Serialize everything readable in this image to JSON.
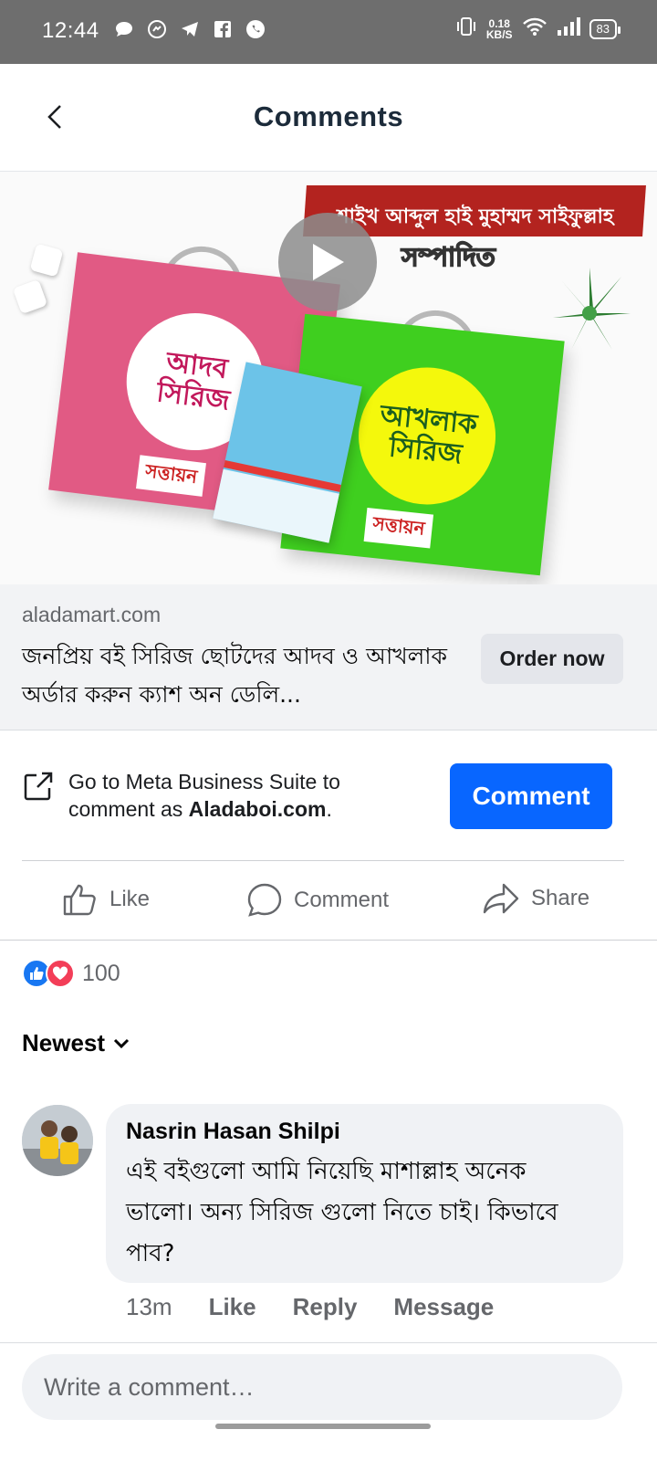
{
  "status_bar": {
    "time": "12:44",
    "net_speed_value": "0.18",
    "net_speed_unit": "KB/S",
    "battery": "83"
  },
  "header": {
    "title": "Comments"
  },
  "ad_media": {
    "banner_text": "শাইখ আব্দুল হাই মুহাম্মদ সাইফুল্লাহ",
    "banner_sub": "সম্পাদিত",
    "pink_bag_label": "আদব সিরিজ",
    "green_bag_label": "আখলাক সিরিজ",
    "brand": "সত্তায়ন"
  },
  "link_preview": {
    "domain": "aladamart.com",
    "title": "জনপ্রিয় বই সিরিজ ছোটদের আদব ও আখলাক অর্ডার করুন ক্যাশ অন ডেলি...",
    "button": "Order now"
  },
  "business_suite": {
    "text_prefix": "Go to Meta Business Suite to comment as ",
    "page_name": "Aladaboi.com",
    "text_suffix": ".",
    "button": "Comment"
  },
  "actions": {
    "like": "Like",
    "comment": "Comment",
    "share": "Share"
  },
  "reactions": {
    "count": "100"
  },
  "sort": {
    "label": "Newest"
  },
  "comments": [
    {
      "author": "Nasrin Hasan Shilpi",
      "text": "এই বইগুলো আমি নিয়েছি মাশাল্লাহ অনেক ভালো। অন্য সিরিজ গুলো নিতে চাই। কিভাবে পাব?",
      "time": "13m",
      "like": "Like",
      "reply": "Reply",
      "message": "Message"
    }
  ],
  "compose": {
    "placeholder": "Write a comment…"
  },
  "colors": {
    "accent": "#0866ff",
    "status_bar": "#6e6e6e",
    "like_reaction": "#1877f2",
    "love_reaction": "#f33e58"
  }
}
